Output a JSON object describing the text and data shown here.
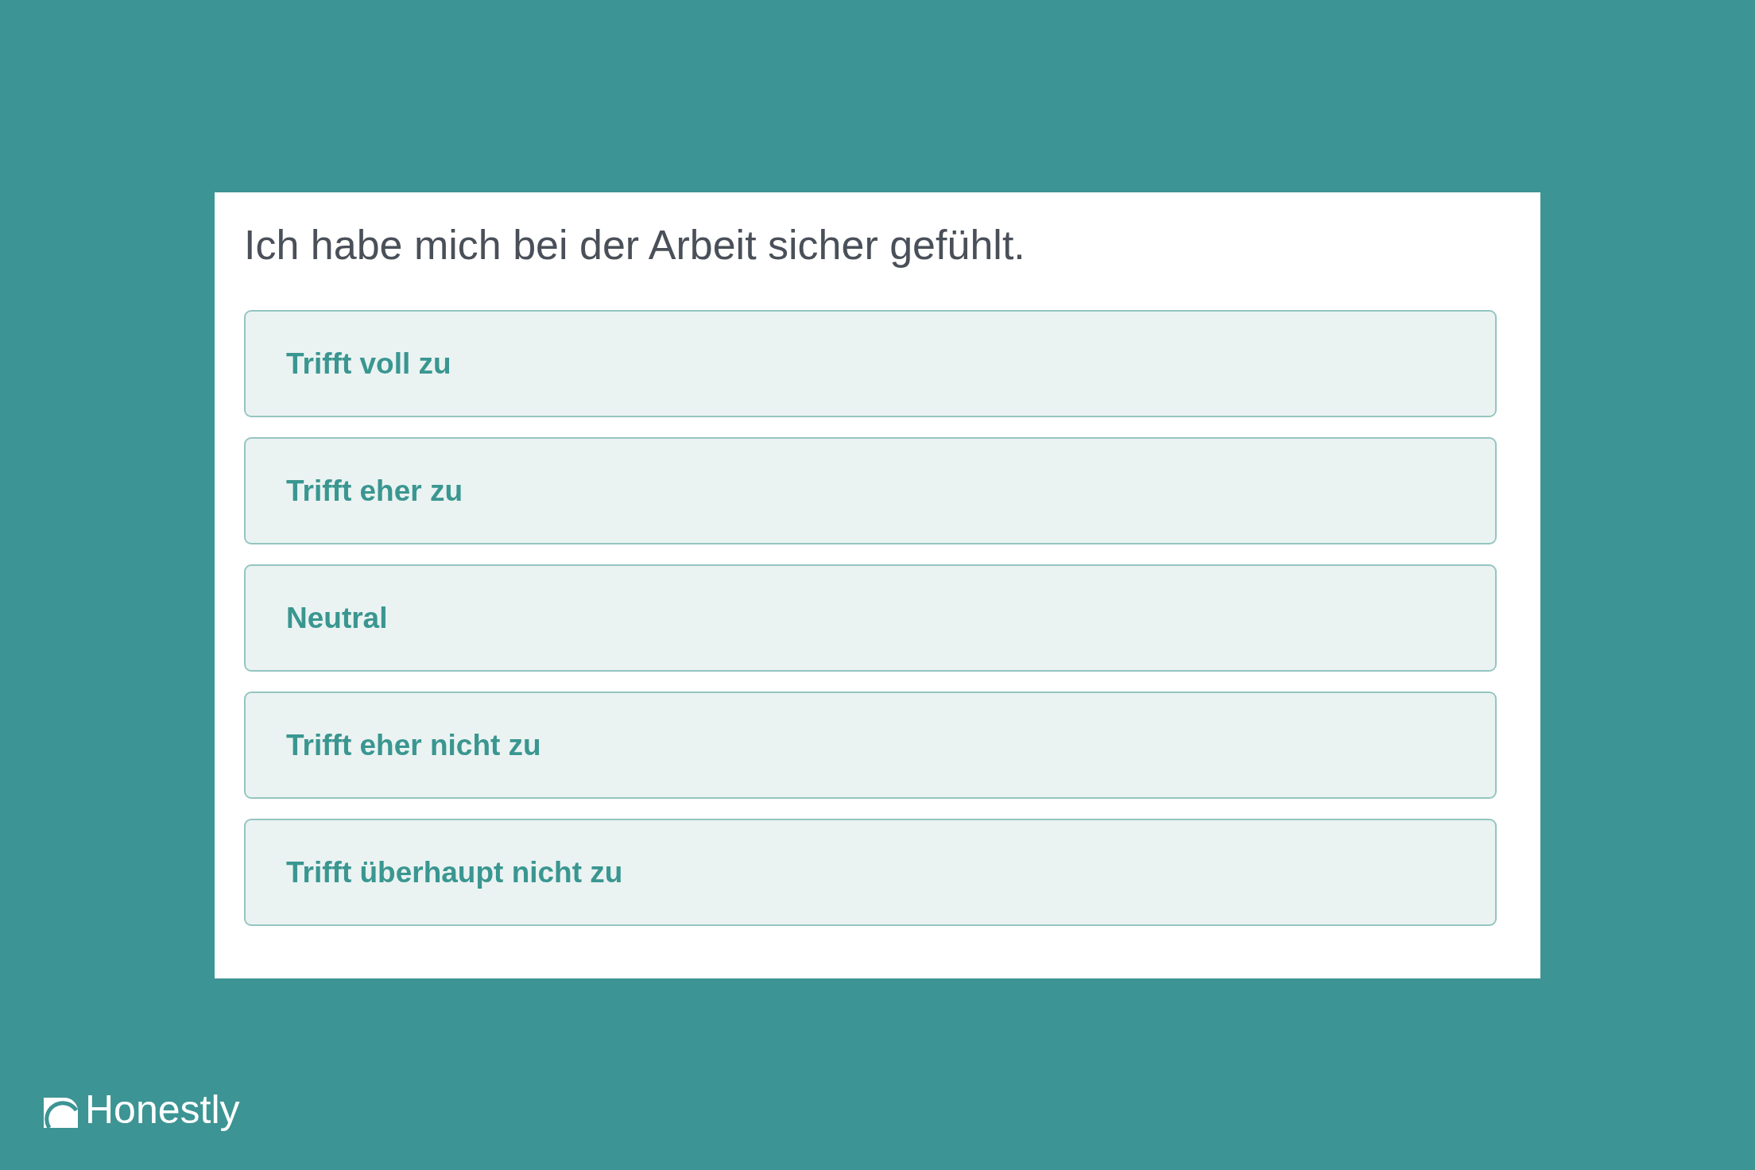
{
  "question": {
    "text": "Ich habe mich bei der Arbeit sicher gefühlt."
  },
  "options": [
    {
      "label": "Trifft voll zu",
      "selected": false
    },
    {
      "label": "Trifft eher zu",
      "selected": false
    },
    {
      "label": "Neutral",
      "selected": false
    },
    {
      "label": "Trifft eher nicht zu",
      "selected": false
    },
    {
      "label": "Trifft überhaupt nicht zu",
      "selected": false
    }
  ],
  "brand": {
    "name": "Honestly"
  }
}
